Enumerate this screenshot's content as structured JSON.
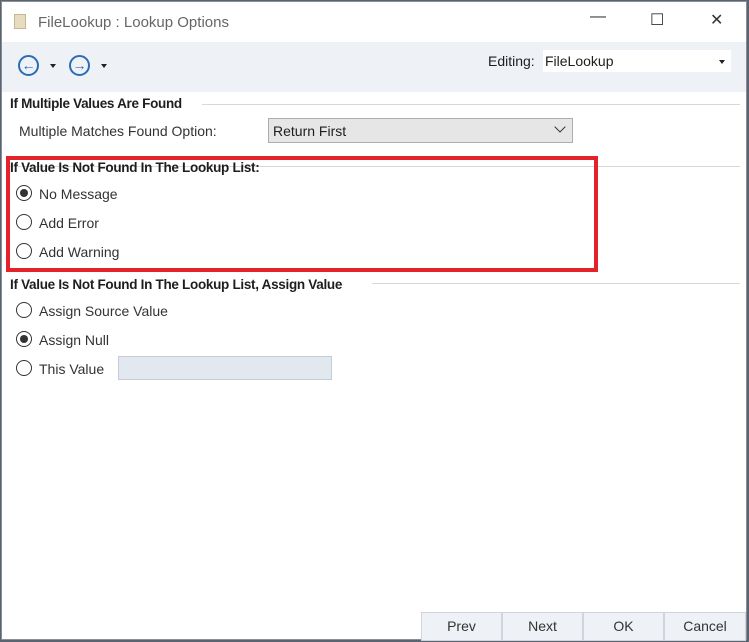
{
  "window": {
    "title": "FileLookup : Lookup Options",
    "minimize": "—",
    "maximize": "☐",
    "close": "✕"
  },
  "toolbar": {
    "back": "←",
    "forward": "→",
    "editing_label": "Editing:",
    "editing_value": "FileLookup"
  },
  "multiple": {
    "heading": "If Multiple Values Are Found",
    "option_label": "Multiple Matches Found Option:",
    "option_value": "Return First"
  },
  "not_found": {
    "heading": "If Value Is Not Found In The Lookup List:",
    "options": [
      {
        "label": "No Message",
        "checked": true
      },
      {
        "label": "Add Error",
        "checked": false
      },
      {
        "label": "Add Warning",
        "checked": false
      }
    ]
  },
  "assign": {
    "heading": "If Value Is Not Found In The Lookup List, Assign Value",
    "options": [
      {
        "label": "Assign Source Value",
        "checked": false
      },
      {
        "label": "Assign Null",
        "checked": true
      },
      {
        "label": "This Value",
        "checked": false
      }
    ],
    "this_value": ""
  },
  "buttons": {
    "prev": "Prev",
    "next": "Next",
    "ok": "OK",
    "cancel": "Cancel"
  }
}
